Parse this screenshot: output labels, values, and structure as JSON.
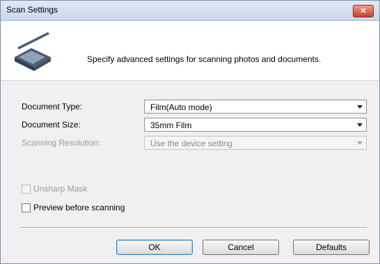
{
  "window": {
    "title": "Scan Settings",
    "close_glyph": "✕"
  },
  "header": {
    "icon": "scanner-icon",
    "description": "Specify advanced settings for scanning photos and documents."
  },
  "fields": {
    "document_type": {
      "label": "Document Type:",
      "value": "Film(Auto mode)"
    },
    "document_size": {
      "label": "Document Size:",
      "value": "35mm Film"
    },
    "scanning_resolution": {
      "label": "Scanning Resolution:",
      "value": "Use the device setting",
      "disabled": true
    }
  },
  "options": {
    "unsharp_mask": {
      "label": "Unsharp Mask",
      "checked": false,
      "disabled": true
    },
    "preview_before_scanning": {
      "label": "Preview before scanning",
      "checked": false,
      "disabled": false
    }
  },
  "buttons": {
    "ok": "OK",
    "cancel": "Cancel",
    "defaults": "Defaults"
  }
}
